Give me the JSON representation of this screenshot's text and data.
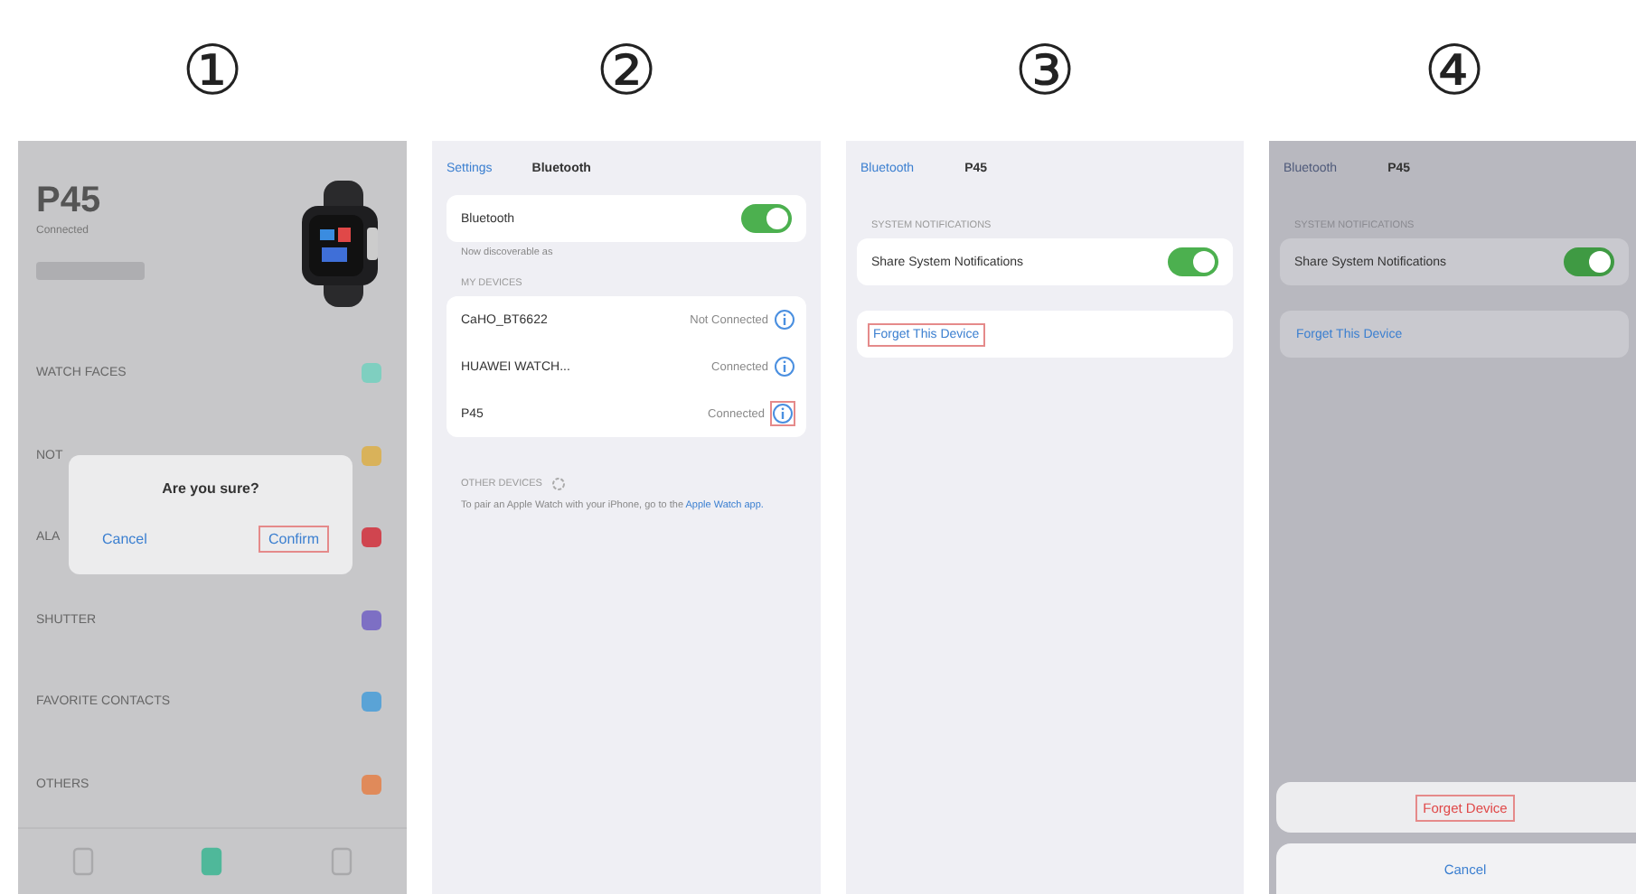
{
  "steps": [
    {
      "number": "①",
      "kind": "watch_app",
      "device_name": "P45",
      "device_status": "Connected",
      "menu": [
        {
          "label": "WATCH FACES",
          "color": "#7fcfc0"
        },
        {
          "label": "NOT",
          "color": "#d9b25a"
        },
        {
          "label": "ALA",
          "color": "#d0454f"
        },
        {
          "label": "SHUTTER",
          "color": "#7d6fc4"
        },
        {
          "label": "FAVORITE CONTACTS",
          "color": "#5aa3d6"
        },
        {
          "label": "OTHERS",
          "color": "#e08a5a"
        }
      ],
      "dialog": {
        "title": "Are you sure?",
        "buttons": [
          {
            "label": "Cancel",
            "highlighted": false
          },
          {
            "label": "Confirm",
            "highlighted": true
          }
        ]
      },
      "tab_bar": [
        {
          "selected": false
        },
        {
          "selected": true
        },
        {
          "selected": false
        }
      ]
    },
    {
      "number": "②",
      "kind": "bluetooth_list",
      "back": "Settings",
      "title": "Bluetooth",
      "toggle": {
        "label": "Bluetooth",
        "on": true
      },
      "note": "Now discoverable as",
      "section": "MY DEVICES",
      "devices": [
        {
          "name": "CaHO_BT6622",
          "status": "Not Connected",
          "highlighted": false
        },
        {
          "name": "HUAWEI WATCH...",
          "status": "Connected",
          "highlighted": false
        },
        {
          "name": "P45",
          "status": "Connected",
          "highlighted": true
        }
      ],
      "other_section": "OTHER DEVICES",
      "hint": "To pair an Apple Watch with your iPhone, go to the",
      "hint_link": "Apple Watch app."
    },
    {
      "number": "③",
      "kind": "device_detail",
      "dimmed": false,
      "back": "Bluetooth",
      "title": "P45",
      "section": "SYSTEM NOTIFICATIONS",
      "toggle": {
        "label": "Share System Notifications",
        "on": true
      },
      "forget": {
        "label": "Forget This Device",
        "highlighted": true
      }
    },
    {
      "number": "④",
      "kind": "device_detail",
      "dimmed": true,
      "back": "Bluetooth",
      "title": "P45",
      "section": "SYSTEM NOTIFICATIONS",
      "toggle": {
        "label": "Share System Notifications",
        "on": true
      },
      "forget": {
        "label": "Forget This Device",
        "highlighted": false
      },
      "action_sheet": [
        {
          "label": "Forget Device",
          "highlighted": true
        },
        {
          "label": "Cancel",
          "highlighted": false
        }
      ]
    }
  ]
}
